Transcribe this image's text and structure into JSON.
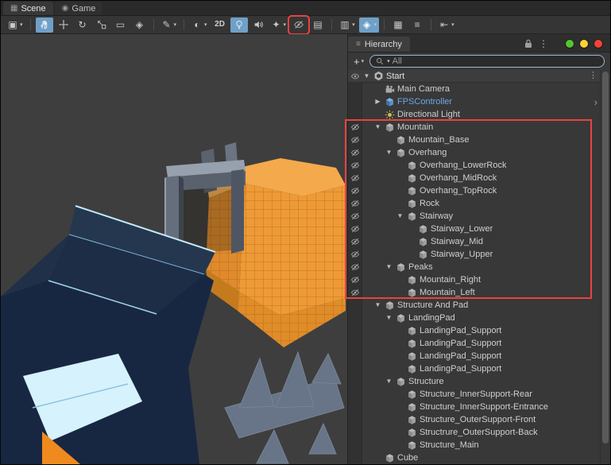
{
  "tabs": {
    "active_index": 0,
    "items": [
      {
        "label": "Scene",
        "icon": "scenetab"
      },
      {
        "label": "Game",
        "icon": "gametab"
      }
    ]
  },
  "toolbar": {
    "groups": [
      {
        "buttons": [
          {
            "name": "tool-handle-settings",
            "icon": "grid",
            "caret": true
          }
        ]
      },
      {
        "buttons": [
          {
            "name": "view-tool",
            "icon": "hand",
            "active": true
          },
          {
            "name": "move-tool",
            "icon": "move"
          },
          {
            "name": "rotate-tool",
            "icon": "rotate"
          },
          {
            "name": "scale-tool",
            "icon": "scale"
          },
          {
            "name": "rect-tool",
            "icon": "rect"
          },
          {
            "name": "transform-tool",
            "icon": "transform"
          }
        ]
      },
      {
        "buttons": [
          {
            "name": "custom-editor-tools",
            "icon": "pen",
            "caret": true
          }
        ]
      },
      {
        "buttons": [
          {
            "name": "draw-mode-dropdown",
            "icon": "sphere",
            "caret": true
          },
          {
            "name": "2d-view-toggle",
            "label": "2D"
          },
          {
            "name": "scene-lighting-toggle",
            "icon": "bulb",
            "active": true
          },
          {
            "name": "scene-audio-toggle",
            "icon": "speaker"
          },
          {
            "name": "effects-dropdown",
            "icon": "star",
            "caret": true
          },
          {
            "name": "scene-visibility-toggle",
            "icon": "eyeoff",
            "annotated": true
          },
          {
            "name": "camera-settings-button",
            "icon": "card"
          }
        ]
      },
      {
        "buttons": [
          {
            "name": "overlays-dropdown",
            "icon": "layers",
            "caret": true
          },
          {
            "name": "component-tools-dropdown",
            "icon": "diamond",
            "caret": true,
            "active": true
          }
        ]
      },
      {
        "buttons": [
          {
            "name": "grid-visibility-button",
            "icon": "grid2"
          },
          {
            "name": "snap-settings-button",
            "icon": "lines"
          }
        ]
      },
      {
        "buttons": [
          {
            "name": "camera-view-dropdown",
            "icon": "skip",
            "caret": true
          }
        ]
      }
    ]
  },
  "hierarchy": {
    "header": {
      "title": "Hierarchy",
      "dots": [
        {
          "name": "green",
          "color": "#55c52f"
        },
        {
          "name": "yellow",
          "color": "#fdd335"
        },
        {
          "name": "red",
          "color": "#f44336"
        }
      ]
    },
    "search": {
      "plus_label": "+",
      "value": "All"
    },
    "rows": [
      {
        "label": "Start",
        "depth": 0,
        "icon": "scene",
        "fold": "open",
        "eye": "visible",
        "right": "kebab",
        "header": true
      },
      {
        "label": "Main Camera",
        "depth": 1,
        "icon": "camera",
        "fold": "none",
        "eye": "none"
      },
      {
        "label": "FPSController",
        "depth": 1,
        "icon": "prefab",
        "fold": "closed",
        "eye": "none",
        "prefab": true,
        "right": "chevron"
      },
      {
        "label": "Directional Light",
        "depth": 1,
        "icon": "light",
        "fold": "none",
        "eye": "none"
      },
      {
        "label": "Mountain",
        "depth": 1,
        "icon": "cube",
        "fold": "open",
        "eye": "hidden"
      },
      {
        "label": "Mountain_Base",
        "depth": 2,
        "icon": "cube",
        "fold": "none",
        "eye": "hidden"
      },
      {
        "label": "Overhang",
        "depth": 2,
        "icon": "cube",
        "fold": "open",
        "eye": "hidden"
      },
      {
        "label": "Overhang_LowerRock",
        "depth": 3,
        "icon": "cube",
        "fold": "none",
        "eye": "hidden"
      },
      {
        "label": "Overhang_MidRock",
        "depth": 3,
        "icon": "cube",
        "fold": "none",
        "eye": "hidden"
      },
      {
        "label": "Overhang_TopRock",
        "depth": 3,
        "icon": "cube",
        "fold": "none",
        "eye": "hidden"
      },
      {
        "label": "Rock",
        "depth": 3,
        "icon": "cube",
        "fold": "none",
        "eye": "hidden"
      },
      {
        "label": "Stairway",
        "depth": 3,
        "icon": "cube",
        "fold": "open",
        "eye": "hidden"
      },
      {
        "label": "Stairway_Lower",
        "depth": 4,
        "icon": "cube",
        "fold": "none",
        "eye": "hidden"
      },
      {
        "label": "Stairway_Mid",
        "depth": 4,
        "icon": "cube",
        "fold": "none",
        "eye": "hidden"
      },
      {
        "label": "Stairway_Upper",
        "depth": 4,
        "icon": "cube",
        "fold": "none",
        "eye": "hidden"
      },
      {
        "label": "Peaks",
        "depth": 2,
        "icon": "cube",
        "fold": "open",
        "eye": "hidden"
      },
      {
        "label": "Mountain_Right",
        "depth": 3,
        "icon": "cube",
        "fold": "none",
        "eye": "hidden"
      },
      {
        "label": "Mountain_Left",
        "depth": 3,
        "icon": "cube",
        "fold": "none",
        "eye": "hidden"
      },
      {
        "label": "Structure And Pad",
        "depth": 1,
        "icon": "cube",
        "fold": "open",
        "eye": "none"
      },
      {
        "label": "LandingPad",
        "depth": 2,
        "icon": "cube",
        "fold": "open",
        "eye": "none"
      },
      {
        "label": "LandingPad_Support",
        "depth": 3,
        "icon": "cube",
        "fold": "none",
        "eye": "none"
      },
      {
        "label": "LandingPad_Support",
        "depth": 3,
        "icon": "cube",
        "fold": "none",
        "eye": "none"
      },
      {
        "label": "LandingPad_Support",
        "depth": 3,
        "icon": "cube",
        "fold": "none",
        "eye": "none"
      },
      {
        "label": "LandingPad_Support",
        "depth": 3,
        "icon": "cube",
        "fold": "none",
        "eye": "none"
      },
      {
        "label": "Structure",
        "depth": 2,
        "icon": "cube",
        "fold": "open",
        "eye": "none"
      },
      {
        "label": "Structure_InnerSupport-Rear",
        "depth": 3,
        "icon": "cube",
        "fold": "none",
        "eye": "none"
      },
      {
        "label": "Structure_InnerSupport-Entrance",
        "depth": 3,
        "icon": "cube",
        "fold": "none",
        "eye": "none"
      },
      {
        "label": "Structure_OuterSupport-Front",
        "depth": 3,
        "icon": "cube",
        "fold": "none",
        "eye": "none"
      },
      {
        "label": "Structrure_OuterSupport-Back",
        "depth": 3,
        "icon": "cube",
        "fold": "none",
        "eye": "none"
      },
      {
        "label": "Structure_Main",
        "depth": 3,
        "icon": "cube",
        "fold": "none",
        "eye": "none"
      },
      {
        "label": "Cube",
        "depth": 1,
        "icon": "cube",
        "fold": "none",
        "eye": "none"
      }
    ]
  },
  "scene_view": {
    "objects": [
      "mountain",
      "door-frame",
      "navy-platform",
      "ghost-structures",
      "corner-structure"
    ],
    "colors": {
      "background": "#3e3e3e",
      "mountain_orange": "#ee9a36",
      "frame_gray": "#656e7c",
      "platform_navy": "#1d2d46",
      "highlight_cyan": "#d6f2fd",
      "ghost_blue": "#8ba1c4"
    }
  },
  "annotations": {
    "targets": [
      "scene-visibility-toggle-button",
      "mountain-hierarchy-group"
    ]
  },
  "colors": {
    "accent": "#6fa0c8",
    "annotation": "#e8433f",
    "prefab_text": "#6ca7e8"
  }
}
